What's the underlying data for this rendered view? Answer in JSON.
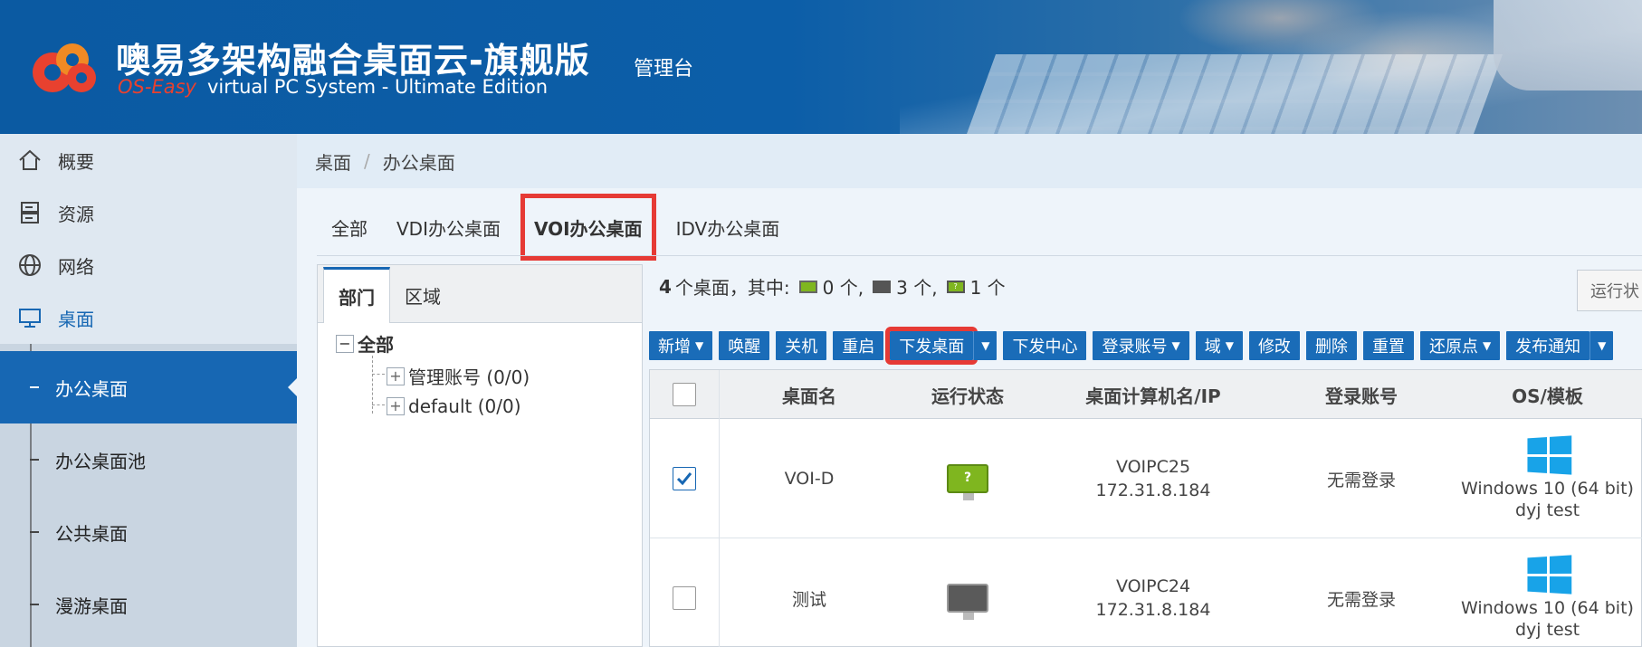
{
  "header": {
    "title": "噢易多架构融合桌面云-旗舰版",
    "subtitle_brand": "OS-Easy",
    "subtitle_text": "virtual PC System - Ultimate Edition",
    "console": "管理台"
  },
  "sidebar": {
    "items": [
      {
        "label": "概要",
        "icon": "home-icon"
      },
      {
        "label": "资源",
        "icon": "server-icon"
      },
      {
        "label": "网络",
        "icon": "globe-icon"
      },
      {
        "label": "桌面",
        "icon": "monitor-icon"
      }
    ],
    "subitems": [
      {
        "label": "办公桌面"
      },
      {
        "label": "办公桌面池"
      },
      {
        "label": "公共桌面"
      },
      {
        "label": "漫游桌面"
      }
    ],
    "accent": "#1767b3"
  },
  "breadcrumb": {
    "root": "桌面",
    "separator": "/",
    "current": "办公桌面"
  },
  "tabs": [
    "全部",
    "VDI办公桌面",
    "VOI办公桌面",
    "IDV办公桌面"
  ],
  "active_tab": "VOI办公桌面",
  "tree": {
    "tabs": [
      "部门",
      "区域"
    ],
    "root": "全部",
    "nodes": [
      "管理账号 (0/0)",
      "default (0/0)"
    ]
  },
  "summary": {
    "count": "4",
    "prefix": "个桌面，其中:",
    "online": "0 个,",
    "offline": "3 个,",
    "unknown": "1 个"
  },
  "status_filter": "运行状",
  "toolbar": {
    "add": "新增",
    "wake": "唤醒",
    "shutdown": "关机",
    "reboot": "重启",
    "deploy": "下发桌面",
    "deploy_center": "下发中心",
    "login_account": "登录账号",
    "domain": "域",
    "modify": "修改",
    "delete": "删除",
    "reset": "重置",
    "restore_point": "还原点",
    "publish_notice": "发布通知"
  },
  "table": {
    "columns": [
      "桌面名",
      "运行状态",
      "桌面计算机名/IP",
      "登录账号",
      "OS/模板"
    ],
    "rows": [
      {
        "checked": true,
        "name": "VOI-D",
        "status": "unknown",
        "status_mark": "?",
        "host": "VOIPC25",
        "ip": "172.31.8.184",
        "login": "无需登录",
        "os": "Windows 10 (64 bit)",
        "template": "dyj test"
      },
      {
        "checked": false,
        "name": "测试",
        "status": "offline",
        "status_mark": "",
        "host": "VOIPC24",
        "ip": "172.31.8.184",
        "login": "无需登录",
        "os": "Windows 10 (64 bit)",
        "template": "dyj test"
      }
    ]
  },
  "colors": {
    "primary": "#1a6cb8",
    "highlight": "#e63a35",
    "status_green": "#7fb61f",
    "status_gray": "#5a5a5a"
  }
}
